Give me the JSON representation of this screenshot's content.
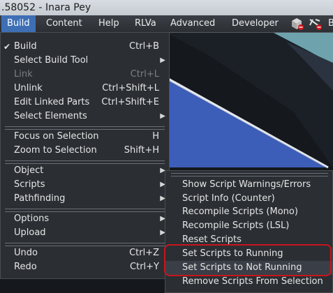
{
  "window": {
    "title": ".58052 - Inara Pey"
  },
  "menubar": {
    "items": [
      "Build",
      "Content",
      "Help",
      "RLVa",
      "Advanced",
      "Developer"
    ],
    "icons": [
      "cube-icon",
      "no-fly-icon"
    ],
    "trailing": "B"
  },
  "build_menu": {
    "items": [
      {
        "label": "Build",
        "shortcut": "Ctrl+B",
        "checked": true
      },
      {
        "label": "Select Build Tool",
        "submenu": true
      },
      {
        "label": "Link",
        "shortcut": "Ctrl+L",
        "disabled": true
      },
      {
        "label": "Unlink",
        "shortcut": "Ctrl+Shift+L"
      },
      {
        "label": "Edit Linked Parts",
        "shortcut": "Ctrl+Shift+E"
      },
      {
        "label": "Select Elements",
        "submenu": true
      },
      {
        "label": "Focus on Selection",
        "shortcut": "H"
      },
      {
        "label": "Zoom to Selection",
        "shortcut": "Shift+H"
      },
      {
        "label": "Object",
        "submenu": true
      },
      {
        "label": "Scripts",
        "submenu": true
      },
      {
        "label": "Pathfinding",
        "submenu": true
      },
      {
        "label": "Options",
        "submenu": true
      },
      {
        "label": "Upload",
        "submenu": true
      },
      {
        "label": "Undo",
        "shortcut": "Ctrl+Z"
      },
      {
        "label": "Redo",
        "shortcut": "Ctrl+Y"
      }
    ]
  },
  "scripts_submenu": {
    "items": [
      "Show Script Warnings/Errors",
      "Script Info (Counter)",
      "Recompile Scripts (Mono)",
      "Recompile Scripts (LSL)",
      "Reset Scripts",
      "Set Scripts to Running",
      "Set Scripts to Not Running",
      "Remove Scripts From Selection"
    ],
    "highlighted": [
      "Set Scripts to Running",
      "Set Scripts to Not Running"
    ],
    "highlight_color": "#c8151d"
  },
  "colors": {
    "menu_bg": "#2b2e33",
    "active_menu": "#3e6fb5",
    "scene_blue": "#3d5eb8"
  }
}
